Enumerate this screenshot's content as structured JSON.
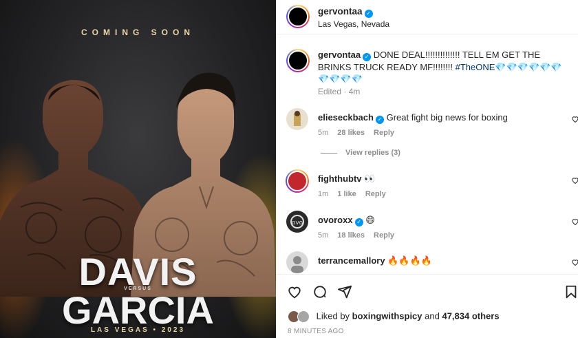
{
  "poster": {
    "coming_soon": "COMING SOON",
    "fighter_a": "DAVIS",
    "versus": "VERSUS",
    "fighter_b": "GARCIA",
    "footer": "LAS VEGAS • 2023"
  },
  "header": {
    "username": "gervontaa",
    "location": "Las Vegas, Nevada"
  },
  "caption": {
    "username": "gervontaa",
    "text": "DONE DEAL!!!!!!!!!!!!!! TELL EM GET THE BRINKS TRUCK READY MF!!!!!!!! ",
    "hashtag": "#TheONE",
    "emojis": "💎💎💎💎💎💎💎💎💎💎",
    "edited": "Edited",
    "time": "4m"
  },
  "comments": [
    {
      "username": "elieseckbach",
      "verified": true,
      "text": "Great fight big news for boxing",
      "time": "5m",
      "likes": "28 likes",
      "reply": "Reply",
      "avatar_color": "#c9a35a"
    },
    {
      "username": "fighthubtv",
      "verified": false,
      "text": "👀",
      "time": "1m",
      "likes": "1 like",
      "reply": "Reply",
      "avatar_color": "#c1272d"
    },
    {
      "username": "ovoroxx",
      "verified": true,
      "text": "😄",
      "time": "5m",
      "likes": "18 likes",
      "reply": "Reply",
      "avatar_color": "#2a2a2a"
    },
    {
      "username": "terrancemallory",
      "verified": false,
      "text": "🔥🔥🔥🔥",
      "time": "",
      "likes": "",
      "reply": "",
      "avatar_color": "#b9b9b9"
    }
  ],
  "view_replies": "View replies (3)",
  "likes": {
    "prefix": "Liked by",
    "user": "boxingwithspicy",
    "suffix": "and",
    "others": "47,834 others"
  },
  "time_ago": "8 MINUTES AGO",
  "colors": {
    "verified": "#0095f6",
    "secondary_text": "#8e8e8e",
    "hashtag": "#00376b"
  }
}
